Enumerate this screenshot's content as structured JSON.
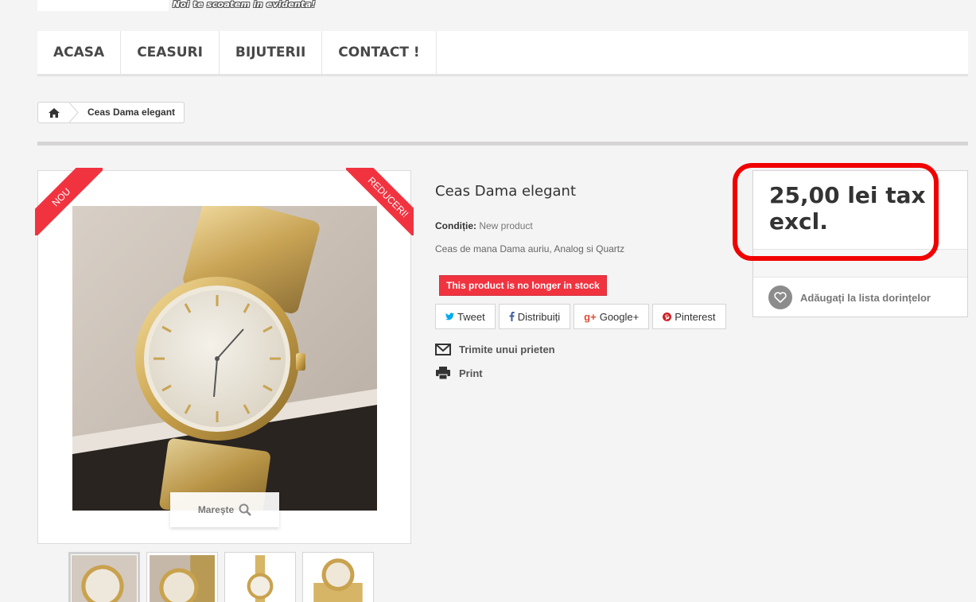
{
  "header": {
    "tagline": "Noi te scoatem in evidenta!"
  },
  "nav": {
    "items": [
      {
        "label": "ACASA"
      },
      {
        "label": "CEASURI"
      },
      {
        "label": "BIJUTERII"
      },
      {
        "label": "CONTACT !"
      }
    ]
  },
  "breadcrumb": {
    "home_icon": "home-icon",
    "current": "Ceas Dama elegant"
  },
  "product": {
    "badge_new": "NOU",
    "badge_sale": "REDUCERI!",
    "zoom_label": "Mareşte",
    "title": "Ceas Dama elegant",
    "condition_label": "Condiție:",
    "condition_value": "New product",
    "short_description": "Ceas de mana Dama auriu, Analog si Quartz",
    "stock_message": "This product is no longer in stock",
    "thumbnail_count": 4
  },
  "social": {
    "tweet": "Tweet",
    "share": "Distribuiți",
    "google": "Google+",
    "pinterest": "Pinterest"
  },
  "links": {
    "send_friend": "Trimite unui prieten",
    "print": "Print"
  },
  "buy": {
    "price": "25,00 lei tax excl.",
    "wishlist": "Adăugați la lista dorințelor"
  },
  "colors": {
    "accent_red": "#f13340",
    "highlight_red": "#f10000",
    "twitter": "#00aaf0",
    "facebook": "#435f9f",
    "google": "#e04b34",
    "pinterest": "#ce1f21"
  }
}
